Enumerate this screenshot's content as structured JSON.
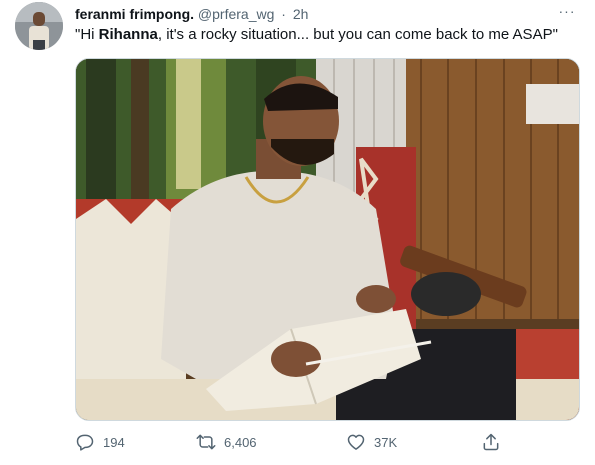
{
  "tweet": {
    "display_name": "feranmi frimpong.",
    "handle": "@prfera_wg",
    "separator": "·",
    "time": "2h",
    "text_before": "\"Hi ",
    "text_bold": "Rihanna",
    "text_after": ", it's a rocky situation... but you can come back to me ASAP\"",
    "more_label": "···"
  },
  "actions": {
    "replies": "194",
    "retweets": "6,406",
    "likes": "37K"
  },
  "icons": {
    "reply": "reply-icon",
    "retweet": "retweet-icon",
    "like": "heart-icon",
    "share": "share-icon",
    "more": "more-icon"
  },
  "colors": {
    "text": "#0f1419",
    "secondary": "#536471",
    "border": "#cfd9de"
  }
}
